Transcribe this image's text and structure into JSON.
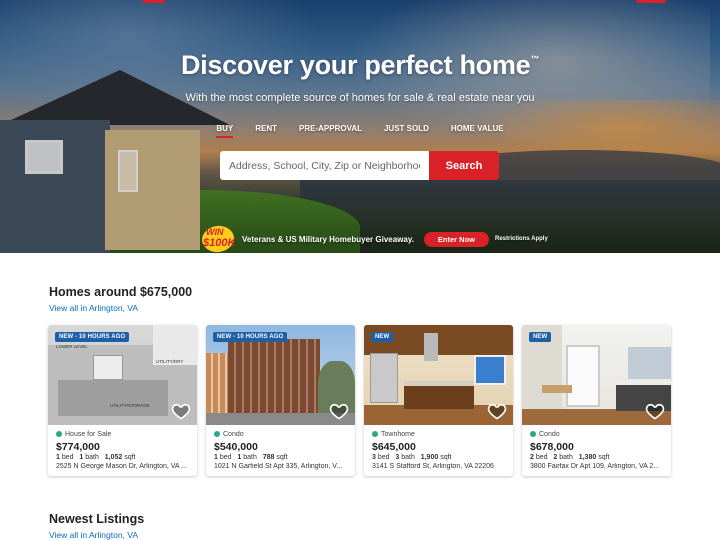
{
  "hero": {
    "title": "Discover your perfect home",
    "title_mark": "™",
    "subtitle": "With the most complete source of homes for sale & real estate near you",
    "tabs": [
      {
        "label": "BUY",
        "active": true
      },
      {
        "label": "RENT",
        "active": false
      },
      {
        "label": "PRE-APPROVAL",
        "active": false
      },
      {
        "label": "JUST SOLD",
        "active": false
      },
      {
        "label": "HOME VALUE",
        "active": false
      }
    ],
    "search": {
      "placeholder": "Address, School, City, Zip or Neighborhood",
      "value": "",
      "button_label": "Search"
    },
    "promo": {
      "badge_line1": "WIN",
      "badge_line2": "$100K",
      "text": "Veterans & US Military Homebuyer Giveaway.",
      "button_label": "Enter Now",
      "note": "Restrictions Apply"
    }
  },
  "homes_around": {
    "title": "Homes around $675,000",
    "link": "View all in Arlington, VA",
    "listings": [
      {
        "badge": "NEW - 10 HOURS AGO",
        "type": "House for Sale",
        "price": "$774,000",
        "beds": "1",
        "beds_label": "bed",
        "baths": "1",
        "baths_label": "bath",
        "sqft": "1,052",
        "sqft_label": "sqft",
        "address": "2525 N George Mason Dr, Arlington, VA ...",
        "photo_labels": [
          "LOWER LEVEL",
          "UTILITY/DRY",
          "UTILITY/STORAGE"
        ]
      },
      {
        "badge": "NEW - 10 HOURS AGO",
        "type": "Condo",
        "price": "$540,000",
        "beds": "1",
        "beds_label": "bed",
        "baths": "1",
        "baths_label": "bath",
        "sqft": "788",
        "sqft_label": "sqft",
        "address": "1021 N Garfield St Apt 335, Arlington, V..."
      },
      {
        "badge": "NEW",
        "type": "Townhome",
        "price": "$645,000",
        "beds": "3",
        "beds_label": "bed",
        "baths": "3",
        "baths_label": "bath",
        "sqft": "1,900",
        "sqft_label": "sqft",
        "address": "3141 S Stafford St, Arlington, VA 22206"
      },
      {
        "badge": "NEW",
        "type": "Condo",
        "price": "$678,000",
        "beds": "2",
        "beds_label": "bed",
        "baths": "2",
        "baths_label": "bath",
        "sqft": "1,380",
        "sqft_label": "sqft",
        "address": "3800 Fairfax Dr Apt 109, Arlington, VA 2..."
      }
    ]
  },
  "newest": {
    "title": "Newest Listings",
    "link": "View all in Arlington, VA"
  },
  "colors": {
    "brand_red": "#d92228",
    "link_blue": "#0b6bbf",
    "badge_blue": "#1e5fa8",
    "status_green": "#2aa58a"
  },
  "icons": {
    "favorite": "heart-outline-icon",
    "status": "status-dot-icon"
  }
}
